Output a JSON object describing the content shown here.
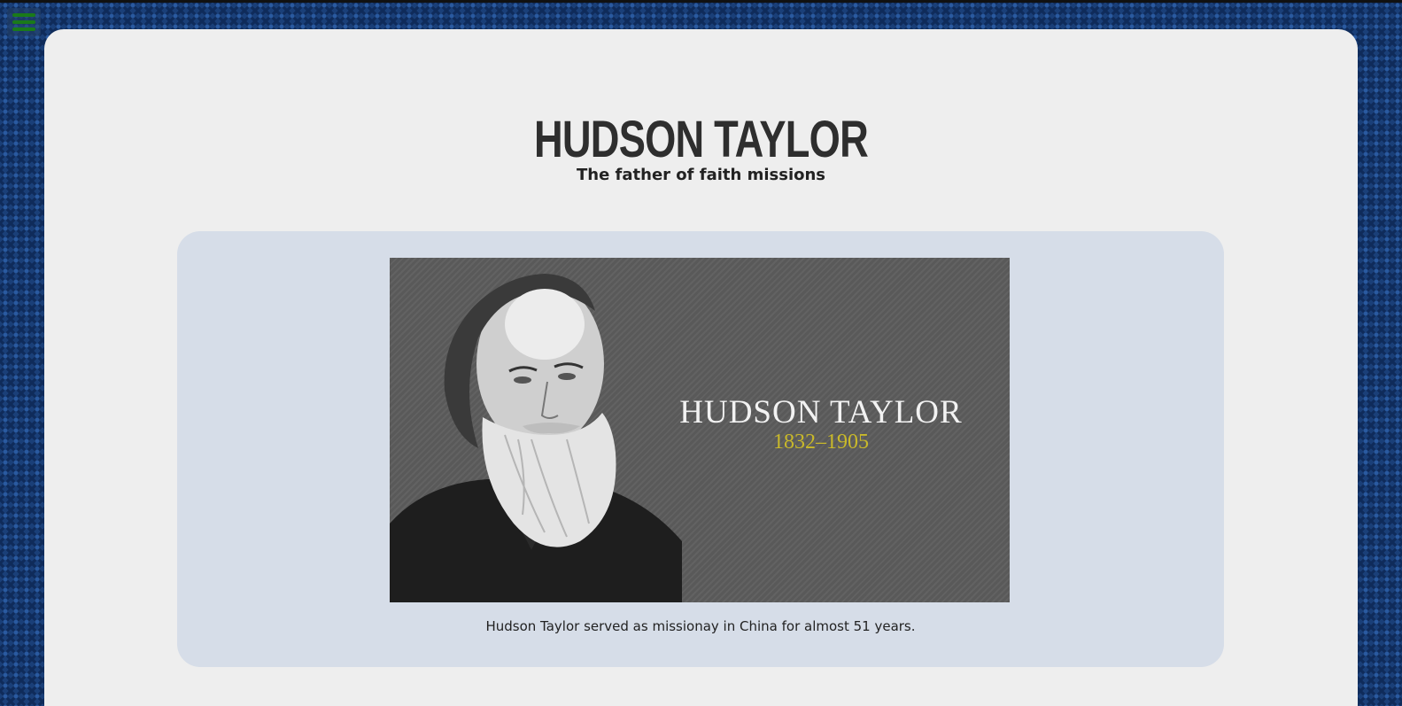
{
  "header": {
    "menu_icon": "hamburger-menu-icon",
    "menu_icon_color": "#1a7a1a"
  },
  "main": {
    "title": "HUDSON TAYLOR",
    "subtitle": "The father of faith missions"
  },
  "figure": {
    "image_name": "HUDSON TAYLOR",
    "image_dates": "1832–1905",
    "caption": "Hudson Taylor served as missionay in China for almost 51 years."
  },
  "colors": {
    "page_background": "#1a3f78",
    "card_background": "#eeeeee",
    "panel_background": "#d6dde8",
    "dates_accent": "#c9b92a"
  }
}
